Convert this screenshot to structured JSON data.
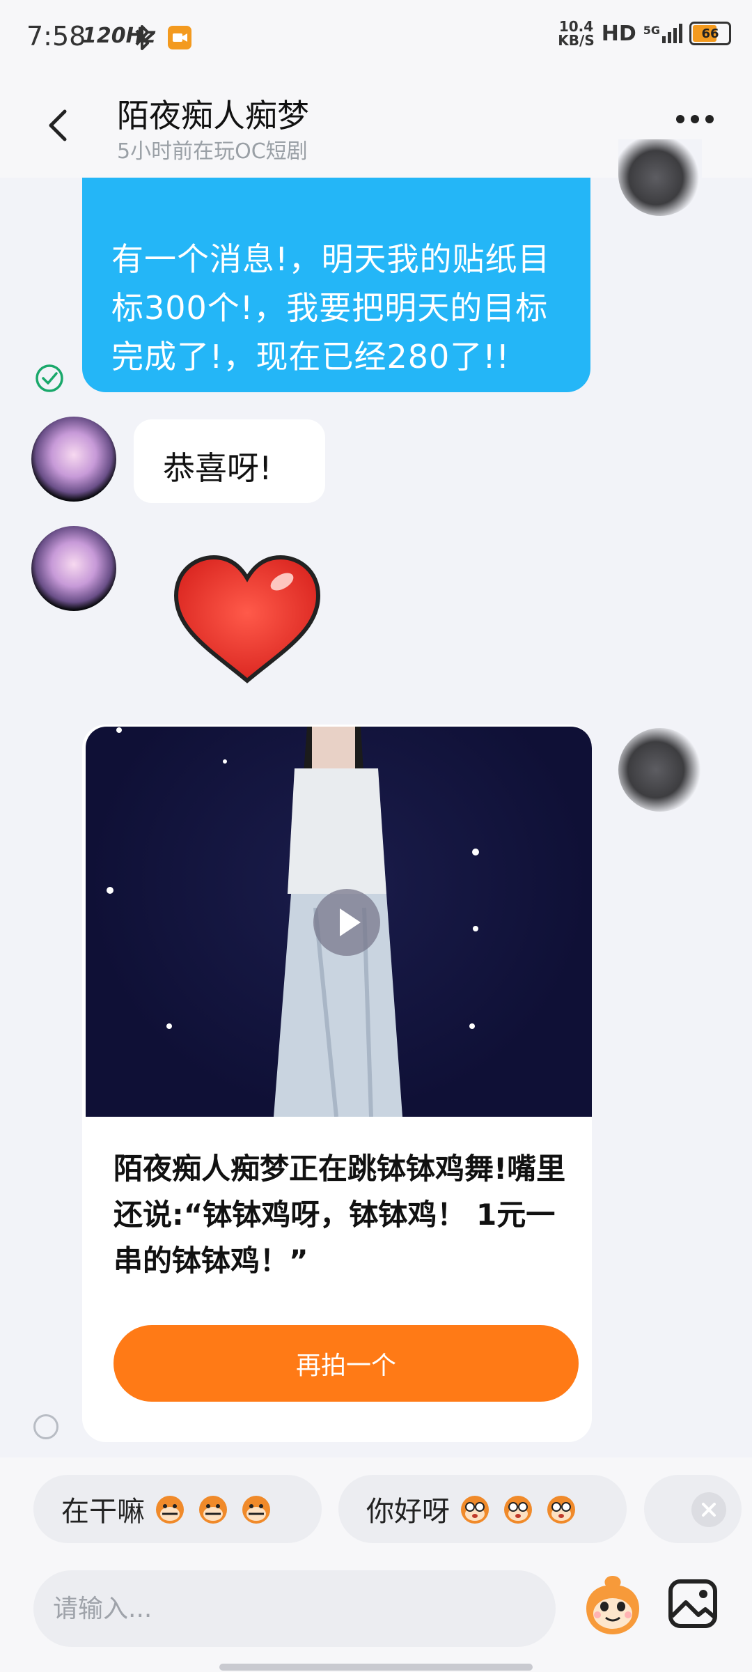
{
  "status_bar": {
    "time": "7:58",
    "refresh_rate": "120Hz",
    "net_speed_value": "10.4",
    "net_speed_unit": "KB/S",
    "hd": "HD",
    "network": "5G",
    "battery": "66"
  },
  "header": {
    "title": "陌夜痴人痴梦",
    "subtitle": "5小时前在玩OC短剧"
  },
  "messages": {
    "m1_text": "有一个消息!，明天我的贴纸目标300个!，我要把明天的目标完成了!，现在已经280了!!",
    "m2_text": "恭喜呀!",
    "m3_sticker": "heart-sticker",
    "video_caption": "陌夜痴人痴梦正在跳钵钵鸡舞!嘴里还说:“钵钵鸡呀，钵钵鸡！ 1元一串的钵钵鸡！”",
    "video_button": "再拍一个"
  },
  "quick_replies": [
    {
      "label": "在干嘛"
    },
    {
      "label": "你好呀"
    }
  ],
  "input": {
    "placeholder": "请输入..."
  },
  "colors": {
    "sent_bubble": "#24b6f7",
    "accent_orange": "#ff7a16",
    "check_green": "#1aa86b"
  }
}
